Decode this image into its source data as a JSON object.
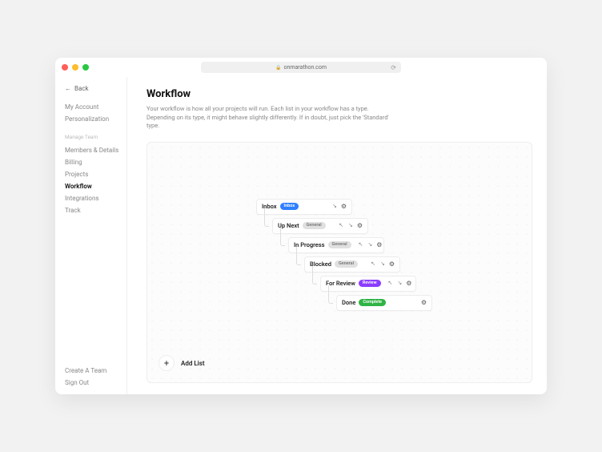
{
  "browser": {
    "url": "onmarathon.com"
  },
  "nav": {
    "back": "Back"
  },
  "sidebar": {
    "personal": [
      {
        "label": "My Account",
        "active": false
      },
      {
        "label": "Personalization",
        "active": false
      }
    ],
    "team_label": "Manage Team",
    "team": [
      {
        "label": "Members & Details",
        "active": false
      },
      {
        "label": "Billing",
        "active": false
      },
      {
        "label": "Projects",
        "active": false
      },
      {
        "label": "Workflow",
        "active": true
      },
      {
        "label": "Integrations",
        "active": false
      },
      {
        "label": "Track",
        "active": false
      }
    ],
    "footer": [
      {
        "label": "Create A Team"
      },
      {
        "label": "Sign Out"
      }
    ]
  },
  "page": {
    "title": "Workflow",
    "description": "Your workflow is how all your projects will run. Each list in your workflow has a type. Depending on its type, it might behave slightly differently. If in doubt, just pick the 'Standard' type."
  },
  "workflow": {
    "items": [
      {
        "label": "Inbox",
        "tag": "Inbox",
        "tag_color": "blue",
        "can_up": false,
        "can_down": true
      },
      {
        "label": "Up Next",
        "tag": "General",
        "tag_color": "grey",
        "can_up": true,
        "can_down": true
      },
      {
        "label": "In Progress",
        "tag": "General",
        "tag_color": "grey",
        "can_up": true,
        "can_down": true
      },
      {
        "label": "Blocked",
        "tag": "General",
        "tag_color": "grey",
        "can_up": true,
        "can_down": true
      },
      {
        "label": "For Review",
        "tag": "Review",
        "tag_color": "purple",
        "can_up": true,
        "can_down": true
      },
      {
        "label": "Done",
        "tag": "Complete",
        "tag_color": "green",
        "can_up": false,
        "can_down": false
      }
    ],
    "add_label": "Add List"
  }
}
